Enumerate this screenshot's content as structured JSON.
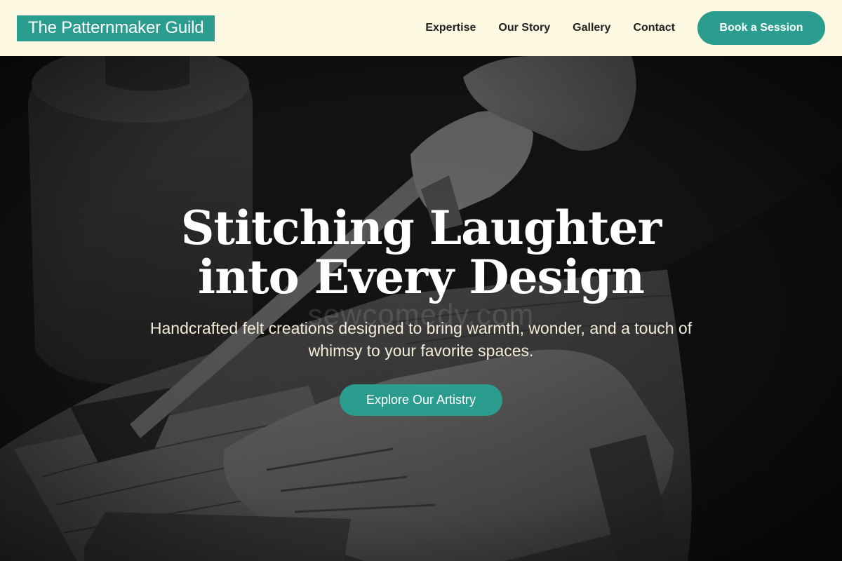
{
  "header": {
    "logo_text": "The Patternmaker Guild",
    "nav": [
      "Expertise",
      "Our Story",
      "Gallery",
      "Contact"
    ],
    "cta_label": "Book a Session"
  },
  "hero": {
    "title": "Stitching Laughter into Every Design",
    "subtitle": "Handcrafted felt creations designed to bring warmth, wonder, and a touch of whimsy to your favorite spaces.",
    "watermark": "sewcomedy.com",
    "cta_label": "Explore Our Artistry",
    "image_subject": "craftsman-carving-wood-photo"
  },
  "colors": {
    "accent": "#2a9d8f",
    "header_bg": "#fdf8e1",
    "nav_text": "#222222",
    "hero_text": "#ffffff",
    "subtitle_text": "#f3ecd8"
  }
}
